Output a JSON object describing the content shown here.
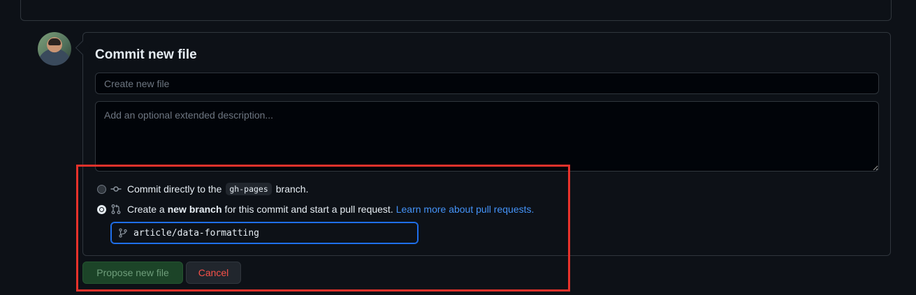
{
  "commit": {
    "title": "Commit new file",
    "summary_placeholder": "Create new file",
    "summary_value": "",
    "description_placeholder": "Add an optional extended description..."
  },
  "options": {
    "direct": {
      "prefix": "Commit directly to the",
      "branch": "gh-pages",
      "suffix": "branch.",
      "selected": false
    },
    "new_branch": {
      "prefix": "Create a",
      "bold": "new branch",
      "suffix": "for this commit and start a pull request.",
      "link": "Learn more about pull requests.",
      "selected": true
    }
  },
  "branch_name": {
    "value": "article/data-formatting"
  },
  "buttons": {
    "propose": "Propose new file",
    "cancel": "Cancel"
  },
  "colors": {
    "background": "#0d1117",
    "link": "#4493f8",
    "highlight_box": "#e8322b",
    "cancel_text": "#f85149",
    "propose_bg": "#1c4428"
  },
  "icons": {
    "commit": "git-commit-icon",
    "pull_request": "git-pull-request-icon",
    "branch": "git-branch-icon"
  }
}
